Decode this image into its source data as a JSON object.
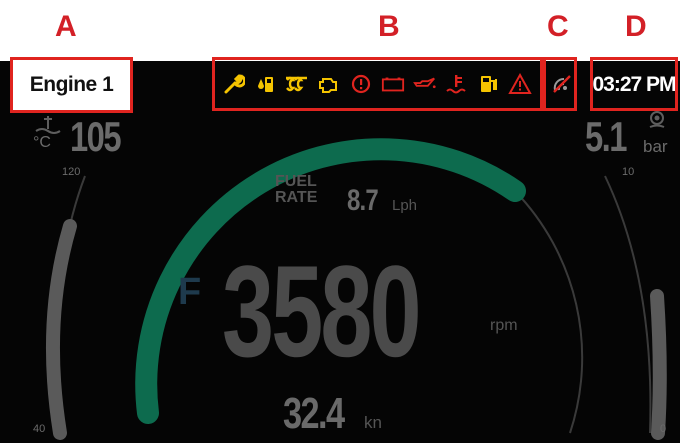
{
  "callouts": {
    "a": "A",
    "b": "B",
    "c": "C",
    "d": "D"
  },
  "header": {
    "engine_label": "Engine 1",
    "clock": "03:27 PM"
  },
  "warning_icons": [
    {
      "name": "wrench-icon",
      "color": "#f5c400"
    },
    {
      "name": "fuel-water-icon",
      "color": "#f5c400"
    },
    {
      "name": "glow-plug-icon",
      "color": "#f5c400"
    },
    {
      "name": "check-engine-icon",
      "color": "#f5c400"
    },
    {
      "name": "stop-icon",
      "color": "#e0241f"
    },
    {
      "name": "battery-icon",
      "color": "#e0241f"
    },
    {
      "name": "oil-pressure-icon",
      "color": "#e0241f"
    },
    {
      "name": "coolant-temp-icon",
      "color": "#e0241f"
    },
    {
      "name": "fuel-pump-icon",
      "color": "#f5c400"
    },
    {
      "name": "warning-triangle-icon",
      "color": "#e0241f"
    }
  ],
  "status_icon": {
    "name": "no-signal-icon",
    "color": "#e0241f"
  },
  "left_gauge": {
    "value": "105",
    "unit": "°C",
    "tick_max": "120",
    "tick_min": "40"
  },
  "right_gauge": {
    "value": "5.1",
    "unit": "bar",
    "tick_max": "10",
    "tick_min": "0"
  },
  "center": {
    "fuel_rate_label_1": "FUEL",
    "fuel_rate_label_2": "RATE",
    "fuel_rate_value": "8.7",
    "fuel_rate_unit": "Lph",
    "gear": "F",
    "rpm_value": "3580",
    "rpm_unit": "rpm",
    "speed_value": "32.4",
    "speed_unit": "kn"
  },
  "colors": {
    "accent_green": "#0d6b4e",
    "callout_red": "#e0241f",
    "warning_yellow": "#f5c400"
  }
}
